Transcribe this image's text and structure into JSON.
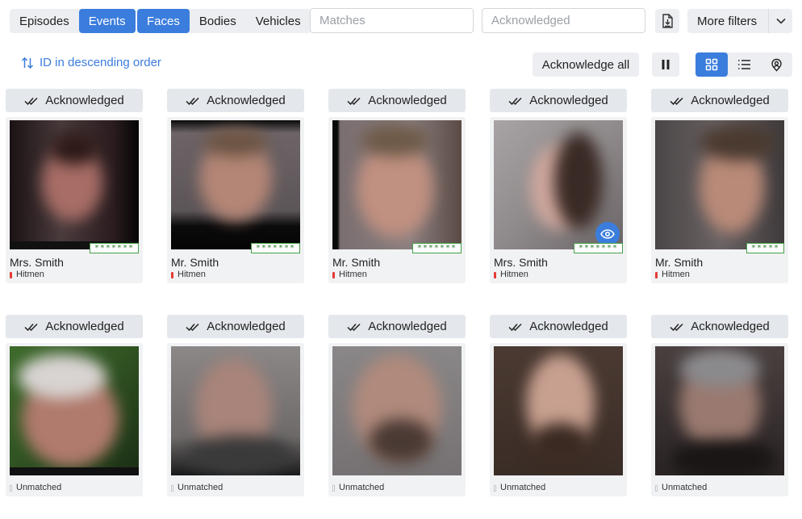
{
  "filters": {
    "type_tabs": [
      {
        "label": "Episodes",
        "active": false
      },
      {
        "label": "Events",
        "active": true
      }
    ],
    "object_tabs": [
      {
        "label": "Faces",
        "active": true
      },
      {
        "label": "Bodies",
        "active": false
      },
      {
        "label": "Vehicles",
        "active": false
      }
    ],
    "matches_placeholder": "Matches",
    "acknowledged_placeholder": "Acknowledged",
    "more_filters_label": "More filters",
    "export_icon": "file-export-icon"
  },
  "sort": {
    "label": "ID in descending order",
    "icon": "sort-arrows-icon"
  },
  "actions": {
    "acknowledge_all_label": "Acknowledge all",
    "pause_icon": "pause-icon",
    "views": [
      {
        "icon": "grid-icon",
        "active": true
      },
      {
        "icon": "list-icon",
        "active": false
      },
      {
        "icon": "face-map-icon",
        "active": false
      }
    ]
  },
  "colors": {
    "accent": "#3b7ddd",
    "matched": "#e53935",
    "badge_border": "#43a047"
  },
  "cards": [
    {
      "ack_label": "Acknowledged",
      "name": "Mrs. Smith",
      "group": "Hitmen",
      "stars": "*******",
      "status": "matched"
    },
    {
      "ack_label": "Acknowledged",
      "name": "Mr. Smith",
      "group": "Hitmen",
      "stars": "*******",
      "status": "matched"
    },
    {
      "ack_label": "Acknowledged",
      "name": "Mr. Smith",
      "group": "Hitmen",
      "stars": "*******",
      "status": "matched"
    },
    {
      "ack_label": "Acknowledged",
      "name": "Mrs. Smith",
      "group": "Hitmen",
      "stars": "*******",
      "status": "matched"
    },
    {
      "ack_label": "Acknowledged",
      "name": "Mr. Smith",
      "group": "Hitmen",
      "stars": "*****",
      "status": "matched"
    },
    {
      "ack_label": "Acknowledged",
      "name": "",
      "group": "Unmatched",
      "stars": "",
      "status": "unmatched"
    },
    {
      "ack_label": "Acknowledged",
      "name": "",
      "group": "Unmatched",
      "stars": "",
      "status": "unmatched"
    },
    {
      "ack_label": "Acknowledged",
      "name": "",
      "group": "Unmatched",
      "stars": "",
      "status": "unmatched"
    },
    {
      "ack_label": "Acknowledged",
      "name": "",
      "group": "Unmatched",
      "stars": "",
      "status": "unmatched"
    },
    {
      "ack_label": "Acknowledged",
      "name": "",
      "group": "Unmatched",
      "stars": "",
      "status": "unmatched"
    }
  ]
}
